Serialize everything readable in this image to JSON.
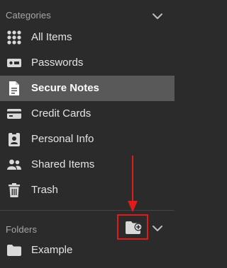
{
  "categories": {
    "title": "Categories",
    "items": [
      {
        "label": "All Items",
        "icon": "grid-icon"
      },
      {
        "label": "Passwords",
        "icon": "password-icon"
      },
      {
        "label": "Secure Notes",
        "icon": "note-icon",
        "selected": true
      },
      {
        "label": "Credit Cards",
        "icon": "credit-card-icon"
      },
      {
        "label": "Personal Info",
        "icon": "id-card-icon"
      },
      {
        "label": "Shared Items",
        "icon": "users-icon"
      },
      {
        "label": "Trash",
        "icon": "trash-icon"
      }
    ]
  },
  "folders": {
    "title": "Folders",
    "add_folder_icon": "folder-plus-icon",
    "items": [
      {
        "label": "Example",
        "icon": "folder-icon"
      }
    ]
  },
  "colors": {
    "background": "#2b2b2b",
    "selected_background": "#595959",
    "text": "#e4e4e4",
    "section_title": "#a7a7a7",
    "annotation": "#e11b1b"
  }
}
